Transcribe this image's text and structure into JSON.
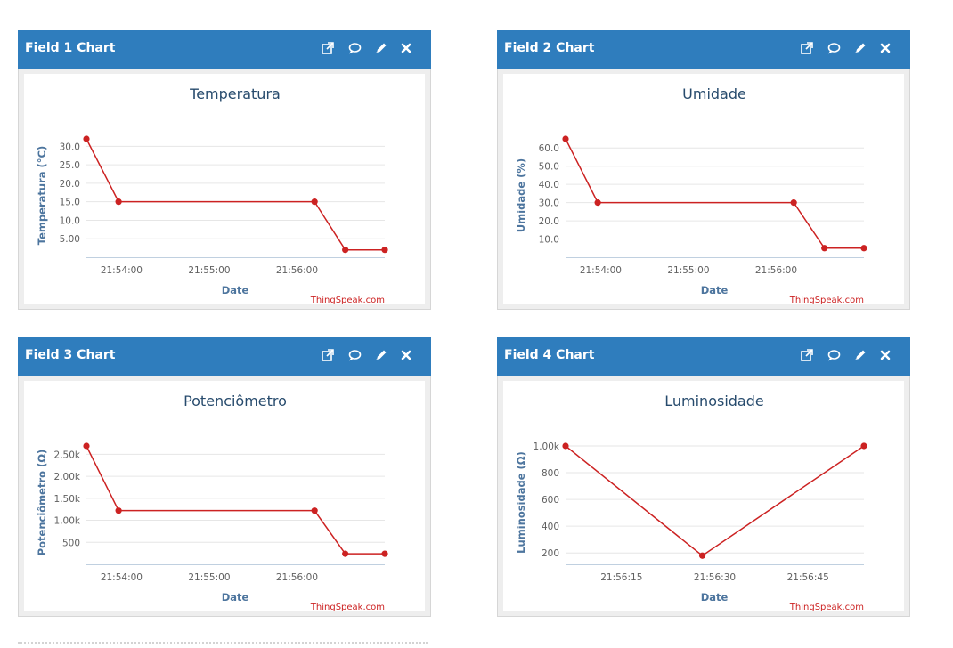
{
  "header_icons": [
    "external-link-icon",
    "comment-icon",
    "pencil-icon",
    "close-icon"
  ],
  "credit_text": "ThingSpeak.com",
  "xlabel": "Date",
  "line_color": "#cc2222",
  "header_color": "#2f7dbd",
  "widgets": [
    {
      "title": "Field 1 Chart",
      "chart_data": {
        "type": "line",
        "title": "Temperatura",
        "xlabel": "Date",
        "ylabel": "Temperatura (°C)",
        "x": [
          "21:53:36",
          "21:53:58",
          "21:56:12",
          "21:56:33",
          "21:57:00"
        ],
        "values": [
          32,
          15,
          15,
          2,
          2
        ],
        "ylim": [
          0,
          32
        ],
        "yticks": [
          5,
          10,
          15,
          20,
          25,
          30
        ],
        "ytick_labels": [
          "5.00",
          "10.0",
          "15.0",
          "20.0",
          "25.0",
          "30.0"
        ],
        "xticks": [
          "21:54:00",
          "21:55:00",
          "21:56:00"
        ],
        "grid": true
      }
    },
    {
      "title": "Field 2 Chart",
      "chart_data": {
        "type": "line",
        "title": "Umidade",
        "xlabel": "Date",
        "ylabel": "Umidade (%)",
        "x": [
          "21:53:36",
          "21:53:58",
          "21:56:12",
          "21:56:33",
          "21:57:00"
        ],
        "values": [
          65,
          30,
          30,
          5,
          5
        ],
        "ylim": [
          0,
          65
        ],
        "yticks": [
          10,
          20,
          30,
          40,
          50,
          60
        ],
        "ytick_labels": [
          "10.0",
          "20.0",
          "30.0",
          "40.0",
          "50.0",
          "60.0"
        ],
        "xticks": [
          "21:54:00",
          "21:55:00",
          "21:56:00"
        ],
        "grid": true
      }
    },
    {
      "title": "Field 3 Chart",
      "chart_data": {
        "type": "line",
        "title": "Potenciômetro",
        "xlabel": "Date",
        "ylabel": "Potenciômetro (Ω)",
        "x": [
          "21:53:36",
          "21:53:58",
          "21:56:12",
          "21:56:33",
          "21:57:00"
        ],
        "values": [
          2690,
          1220,
          1220,
          240,
          240
        ],
        "ylim": [
          0,
          2690
        ],
        "yticks": [
          500,
          1000,
          1500,
          2000,
          2500
        ],
        "ytick_labels": [
          "500",
          "1.00k",
          "1.50k",
          "2.00k",
          "2.50k"
        ],
        "xticks": [
          "21:54:00",
          "21:55:00",
          "21:56:00"
        ],
        "grid": true
      }
    },
    {
      "title": "Field 4 Chart",
      "chart_data": {
        "type": "line",
        "title": "Luminosidade",
        "xlabel": "Date",
        "ylabel": "Luminosidade (Ω)",
        "x": [
          "21:56:06",
          "21:56:28",
          "21:56:54"
        ],
        "values": [
          1000,
          180,
          1000
        ],
        "ylim": [
          115,
          1000
        ],
        "yticks": [
          200,
          400,
          600,
          800,
          1000
        ],
        "ytick_labels": [
          "200",
          "400",
          "600",
          "800",
          "1.00k"
        ],
        "xticks": [
          "21:56:15",
          "21:56:30",
          "21:56:45"
        ],
        "grid": true
      }
    }
  ]
}
